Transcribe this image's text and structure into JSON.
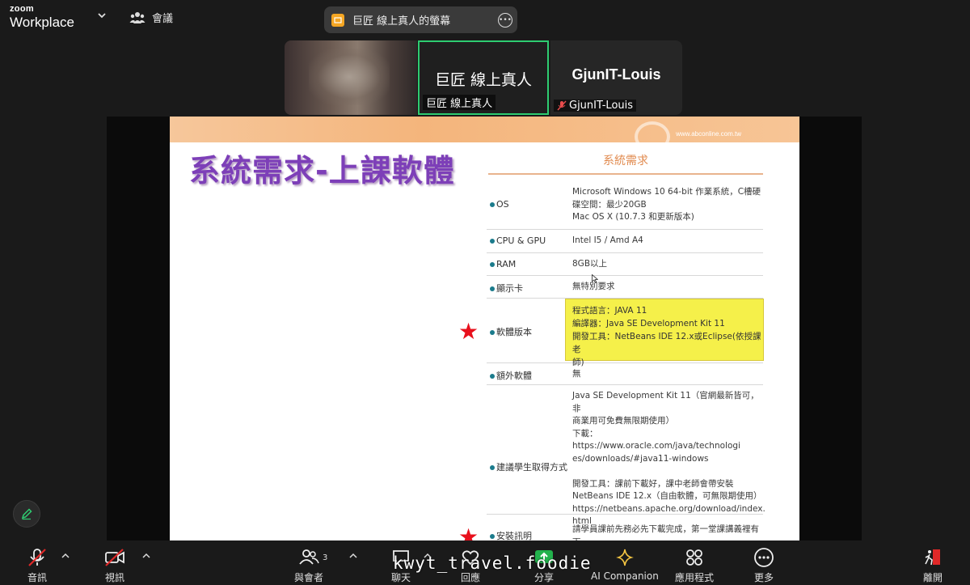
{
  "app": {
    "logo_top": "zoom",
    "logo_bottom": "Workplace"
  },
  "topbar": {
    "meeting_label": "會議",
    "share_title": "巨匠 線上真人的螢幕"
  },
  "participants": [
    {
      "display": "",
      "name": ""
    },
    {
      "display": "巨匠 線上真人",
      "name": "巨匠 線上真人"
    },
    {
      "display": "GjunIT-Louis",
      "name": "GjunIT-Louis"
    }
  ],
  "slide": {
    "site": "www.abconline.com.tw",
    "title": "系統需求-上課軟體",
    "section": "系統需求",
    "rows": [
      {
        "label": "OS",
        "value": "Microsoft Windows 10 64-bit 作業系統，C槽硬\n碟空間：最少20GB\nMac OS X (10.7.3 和更新版本)"
      },
      {
        "label": "CPU & GPU",
        "value": "Intel I5 / Amd A4"
      },
      {
        "label": "RAM",
        "value": "8GB以上"
      },
      {
        "label": "顯示卡",
        "value": "無特別要求"
      },
      {
        "label": "軟體版本",
        "value": "程式語言：JAVA 11\n編譯器：Java SE Development Kit 11\n開發工具：NetBeans IDE 12.x或Eclipse(依授課老\n師)"
      },
      {
        "label": "額外軟體",
        "value": "無"
      },
      {
        "label": "建議學生取得方式",
        "value": "Java SE Development Kit 11（官網最新皆可，非\n商業用可免費無限期使用）\n下載：https://www.oracle.com/java/technologi\nes/downloads/#java11-windows\n\n開發工具：課前下載好，課中老師會帶安裝\nNetBeans IDE 12.x（自由軟體，可無限期使用）\nhttps://netbeans.apache.org/download/index.\nhtml"
      },
      {
        "label": "安裝訊明",
        "value": "請學員課前先務必先下載完成，第一堂課講義裡有下\n載路徑，上課講師會帶領安裝"
      }
    ]
  },
  "bottombar": {
    "audio": "音訊",
    "video": "視訊",
    "participants": "與會者",
    "participants_count": "3",
    "chat": "聊天",
    "react": "回應",
    "share": "分享",
    "ai": "AI Companion",
    "apps": "應用程式",
    "more": "更多",
    "leave": "離開"
  },
  "watermark": "kwyt_travel.foodie",
  "colors": {
    "accent_green": "#2ecc71",
    "share_badge": "#f5a623",
    "leave_red": "#e02828",
    "slide_title": "#7d3fb8",
    "highlight": "#f5f04a"
  }
}
